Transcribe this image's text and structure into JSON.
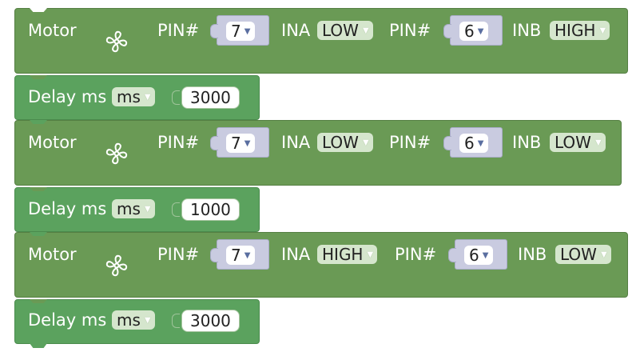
{
  "blocks": [
    {
      "type": "motor",
      "label": "Motor",
      "fan_icon": "fan-icon",
      "pin_a_label": "PIN#",
      "pin_a_value": "7",
      "ina_label": "INA",
      "ina_value": "LOW",
      "pin_b_label": "PIN#",
      "pin_b_value": "6",
      "inb_label": "INB",
      "inb_value": "HIGH"
    },
    {
      "type": "delay",
      "label": "Delay ms",
      "unit_value": "ms",
      "value": "3000"
    },
    {
      "type": "motor",
      "label": "Motor",
      "fan_icon": "fan-icon",
      "pin_a_label": "PIN#",
      "pin_a_value": "7",
      "ina_label": "INA",
      "ina_value": "LOW",
      "pin_b_label": "PIN#",
      "pin_b_value": "6",
      "inb_label": "INB",
      "inb_value": "LOW"
    },
    {
      "type": "delay",
      "label": "Delay ms",
      "unit_value": "ms",
      "value": "1000"
    },
    {
      "type": "motor",
      "label": "Motor",
      "fan_icon": "fan-icon",
      "pin_a_label": "PIN#",
      "pin_a_value": "7",
      "ina_label": "INA",
      "ina_value": "HIGH",
      "pin_b_label": "PIN#",
      "pin_b_value": "6",
      "inb_label": "INB",
      "inb_value": "LOW"
    },
    {
      "type": "delay",
      "label": "Delay ms",
      "unit_value": "ms",
      "value": "3000"
    }
  ],
  "colors": {
    "motor_block": "#6a9a55",
    "delay_block": "#5ba25e",
    "pin_socket": "#c9cbe0",
    "dropdown": "#d5e6cd"
  }
}
